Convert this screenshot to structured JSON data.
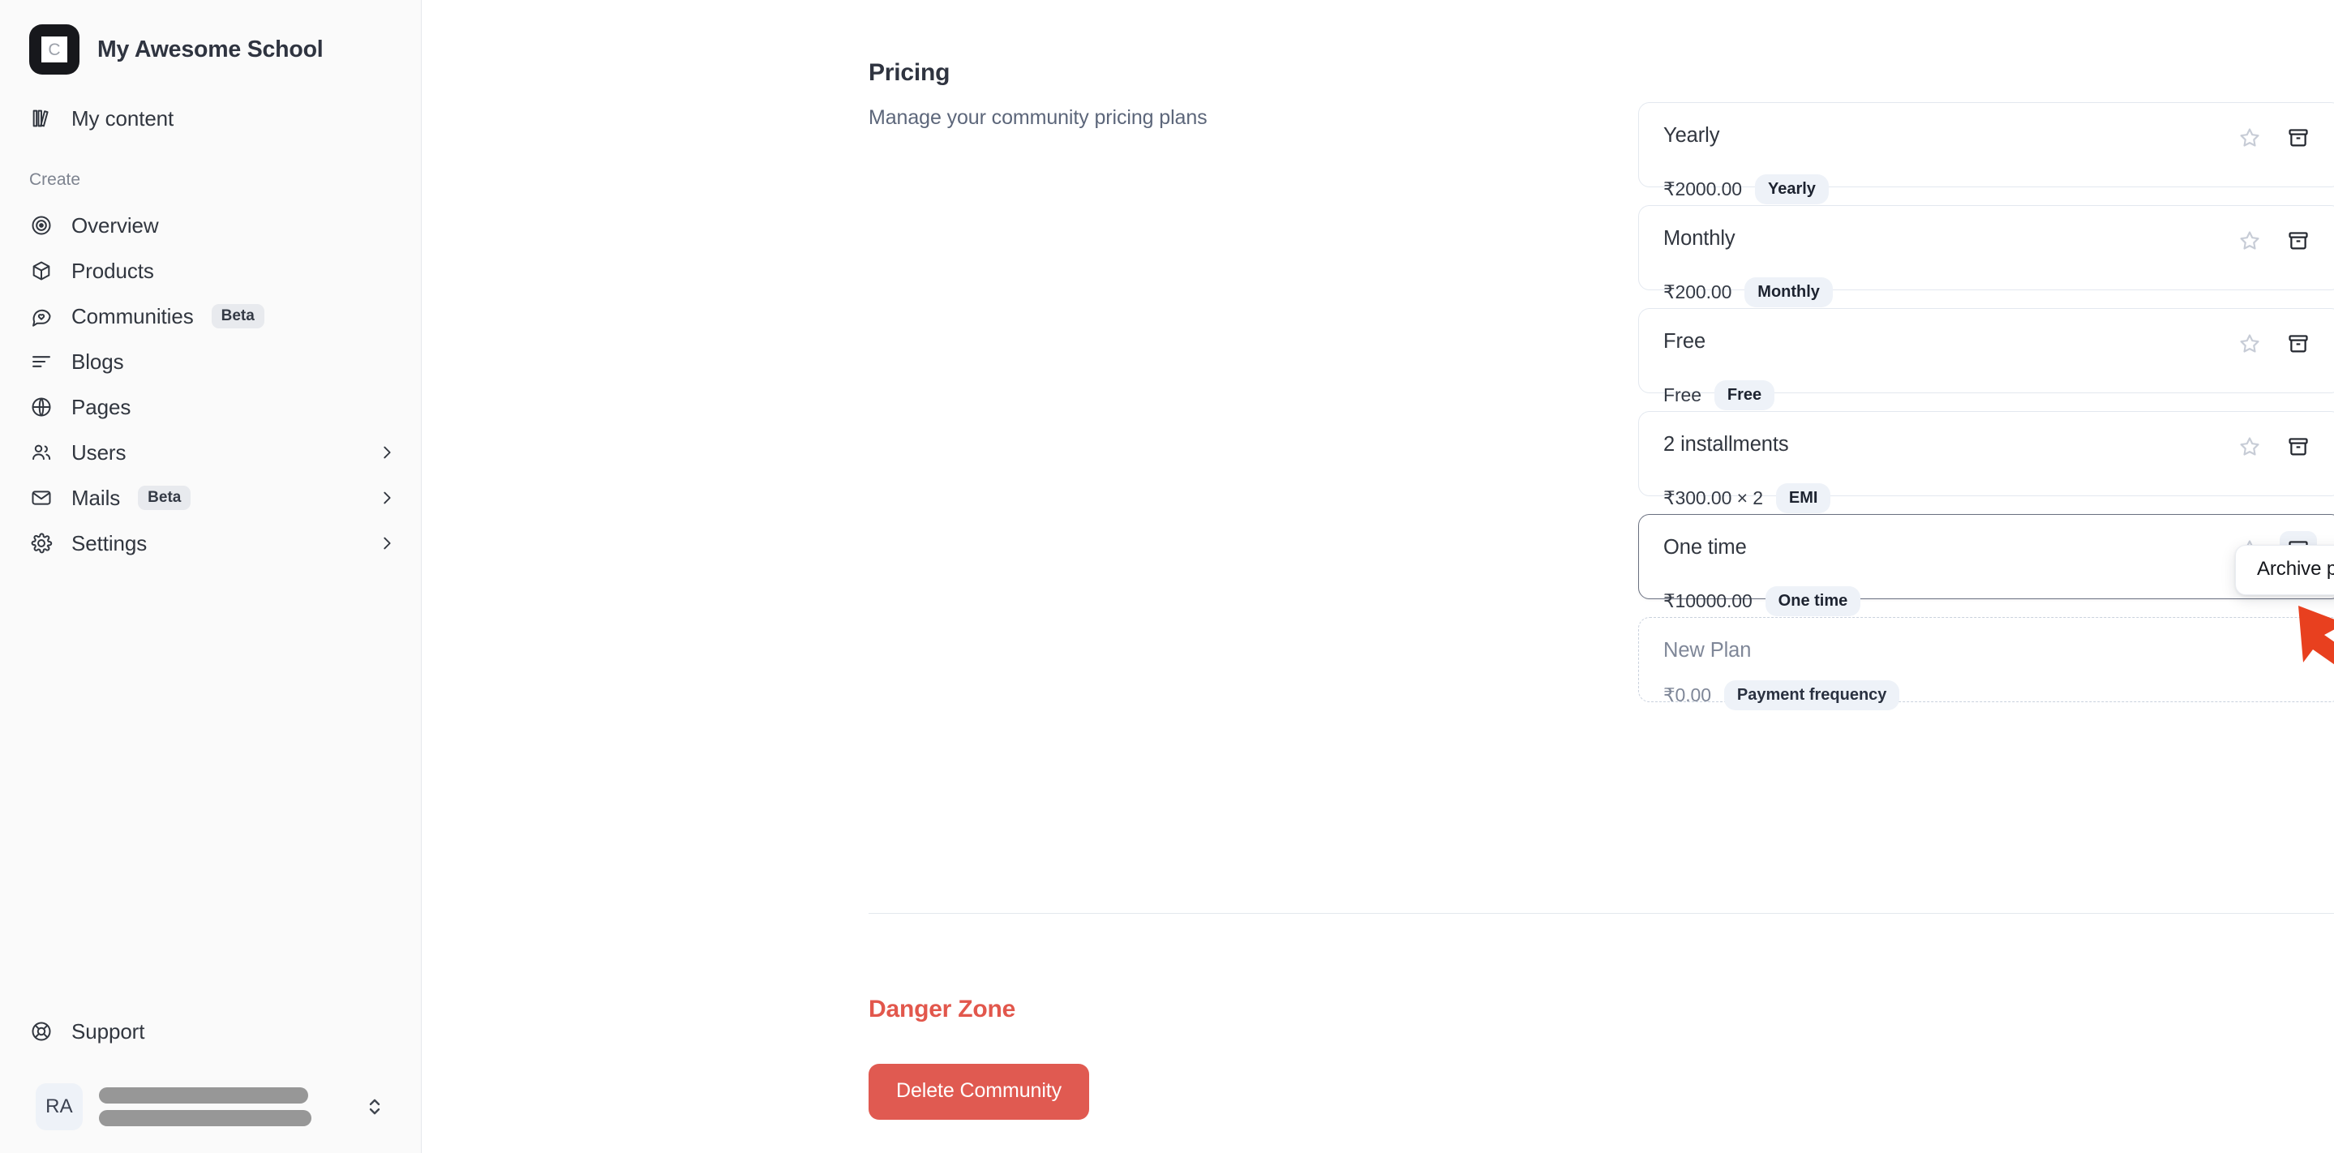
{
  "sidebar": {
    "brand": {
      "name": "My Awesome School",
      "logo_letter": "C"
    },
    "top_items": [
      {
        "label": "My content",
        "icon": "books-icon"
      }
    ],
    "section_label": "Create",
    "items": [
      {
        "label": "Overview",
        "icon": "target-icon",
        "badge": "",
        "chevron": false
      },
      {
        "label": "Products",
        "icon": "box-icon",
        "badge": "",
        "chevron": false
      },
      {
        "label": "Communities",
        "icon": "chat-heart-icon",
        "badge": "Beta",
        "chevron": false
      },
      {
        "label": "Blogs",
        "icon": "lines-icon",
        "badge": "",
        "chevron": false
      },
      {
        "label": "Pages",
        "icon": "globe-icon",
        "badge": "",
        "chevron": false
      },
      {
        "label": "Users",
        "icon": "users-icon",
        "badge": "",
        "chevron": true
      },
      {
        "label": "Mails",
        "icon": "mail-icon",
        "badge": "Beta",
        "chevron": true
      },
      {
        "label": "Settings",
        "icon": "gear-icon",
        "badge": "",
        "chevron": true
      }
    ],
    "support": {
      "label": "Support",
      "icon": "lifebuoy-icon"
    },
    "user": {
      "initials": "RA",
      "name_redacted": true
    }
  },
  "main": {
    "title": "Pricing",
    "subtitle": "Manage your community pricing plans",
    "plans": [
      {
        "name": "Yearly",
        "price": "₹2000.00",
        "badge": "Yearly",
        "state": "normal"
      },
      {
        "name": "Monthly",
        "price": "₹200.00",
        "badge": "Monthly",
        "state": "normal"
      },
      {
        "name": "Free",
        "price": "Free",
        "badge": "Free",
        "state": "normal"
      },
      {
        "name": "2 installments",
        "price": "₹300.00 × 2",
        "badge": "EMI",
        "state": "normal"
      },
      {
        "name": "One time",
        "price": "₹10000.00",
        "badge": "One time",
        "state": "active"
      },
      {
        "name": "New Plan",
        "price": "₹0.00",
        "badge": "Payment frequency",
        "state": "new"
      }
    ],
    "tooltip": "Archive plan",
    "danger": {
      "title": "Danger Zone",
      "delete_label": "Delete Community"
    }
  },
  "colors": {
    "danger": "#e05a51",
    "danger_text": "#e2574c",
    "badge_bg": "#eef2f8",
    "sidebar_bg": "#fafafa",
    "annotation_arrow": "#e8401f"
  }
}
